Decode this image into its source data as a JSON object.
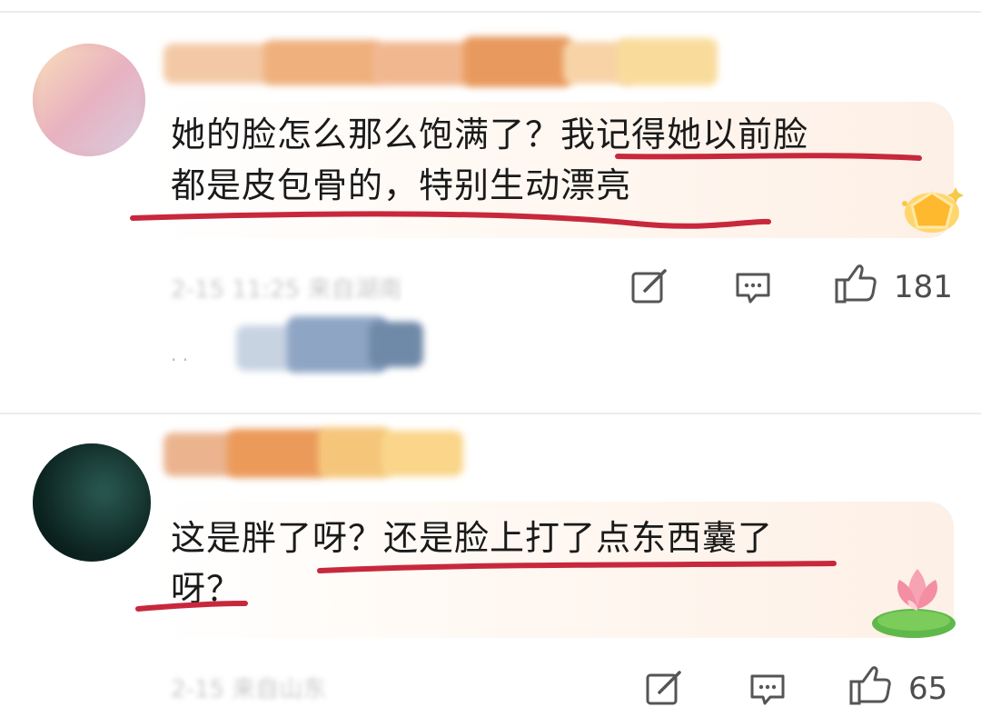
{
  "comments": [
    {
      "text": "她的脸怎么那么饱满了？我记得她以前脸\n都是皮包骨的，特别生动漂亮",
      "meta": "2-15 11:25 来自湖南",
      "like_count": "181"
    },
    {
      "text": "这是胖了呀？还是脸上打了点东西囊了\n呀？",
      "meta": "2-15 来自山东",
      "like_count": "65"
    }
  ],
  "icons": {
    "edit": "pencil-square-icon",
    "reply": "speech-bubble-icon",
    "like": "thumbs-up-icon"
  },
  "colors": {
    "underline": "#c8283c",
    "text": "#1a1a1a",
    "meta": "#c9c9c9",
    "icon": "#555555"
  }
}
